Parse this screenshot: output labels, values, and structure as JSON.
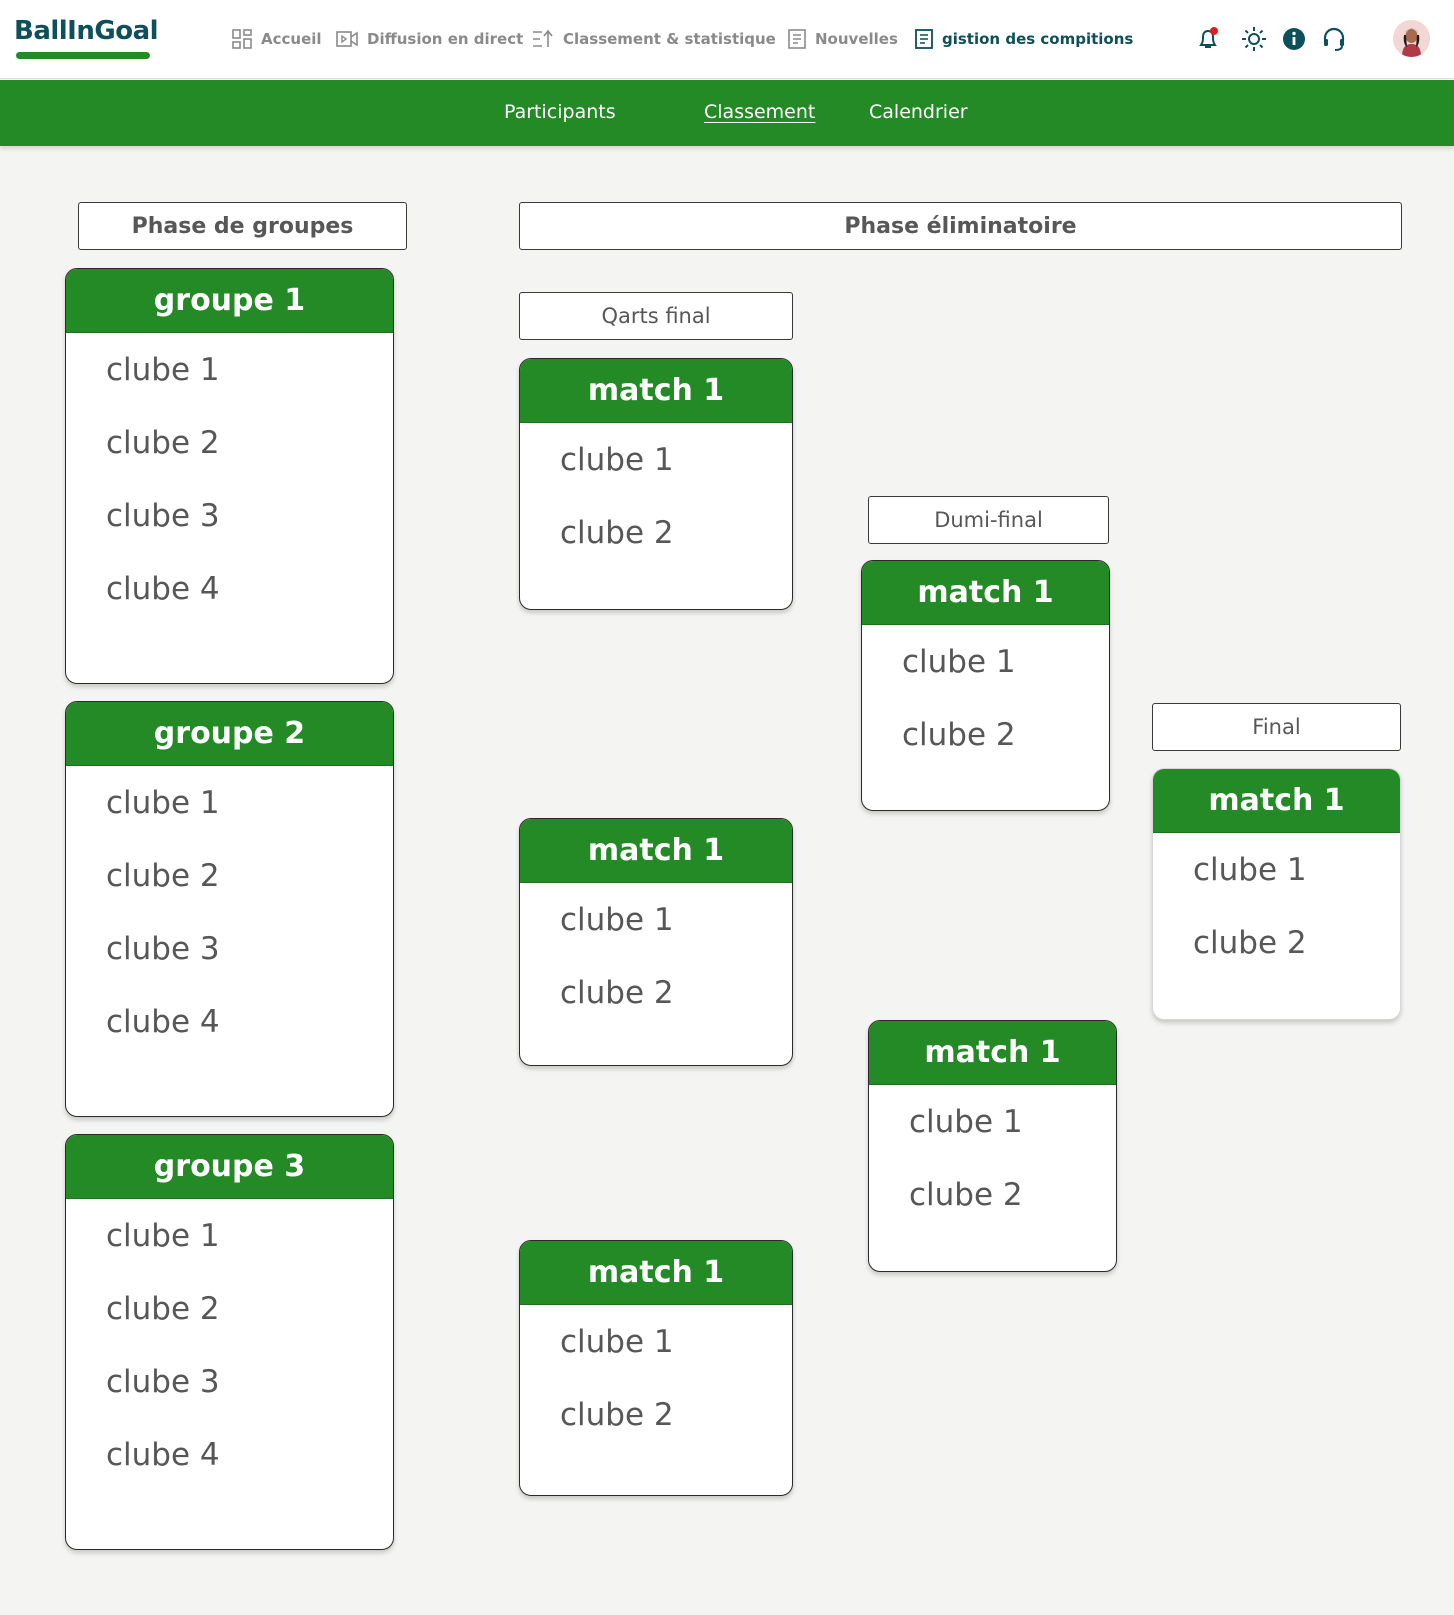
{
  "brand": {
    "logo_text": "BallInGoal",
    "accent": "#238a26",
    "dark": "#0d4f5a"
  },
  "nav": {
    "items": [
      {
        "label": "Accueil",
        "icon": "grid-icon"
      },
      {
        "label": "Diffusion en direct",
        "icon": "video-icon"
      },
      {
        "label": "Classement & statistique",
        "icon": "sort-icon"
      },
      {
        "label": "Nouvelles",
        "icon": "document-icon"
      },
      {
        "label": "gistion des compitions",
        "icon": "document-list-icon",
        "active": true
      }
    ],
    "actions": [
      "bell-icon",
      "sun-icon",
      "info-icon",
      "headset-icon",
      "avatar"
    ]
  },
  "subnav": {
    "tabs": [
      {
        "label": "Participants"
      },
      {
        "label": "Classement",
        "active": true
      },
      {
        "label": "Calendrier"
      }
    ]
  },
  "sections": {
    "groups": "Phase de groupes",
    "knockout": "Phase éliminatoire",
    "quarter": "Qarts final",
    "semi": "Dumi-final",
    "final": "Final"
  },
  "groups": [
    {
      "title": "groupe 1",
      "clubs": [
        "clube 1",
        "clube 2",
        "clube 3",
        "clube 4"
      ]
    },
    {
      "title": "groupe 2",
      "clubs": [
        "clube 1",
        "clube 2",
        "clube 3",
        "clube 4"
      ]
    },
    {
      "title": "groupe 3",
      "clubs": [
        "clube 1",
        "clube 2",
        "clube 3",
        "clube 4"
      ]
    }
  ],
  "quarter_matches": [
    {
      "title": "match 1",
      "clubs": [
        "clube 1",
        "clube 2"
      ]
    },
    {
      "title": "match 1",
      "clubs": [
        "clube 1",
        "clube 2"
      ]
    },
    {
      "title": "match 1",
      "clubs": [
        "clube 1",
        "clube 2"
      ]
    }
  ],
  "semi_matches": [
    {
      "title": "match 1",
      "clubs": [
        "clube 1",
        "clube 2"
      ]
    },
    {
      "title": "match 1",
      "clubs": [
        "clube 1",
        "clube 2"
      ]
    }
  ],
  "final_match": {
    "title": "match 1",
    "clubs": [
      "clube 1",
      "clube 2"
    ]
  }
}
